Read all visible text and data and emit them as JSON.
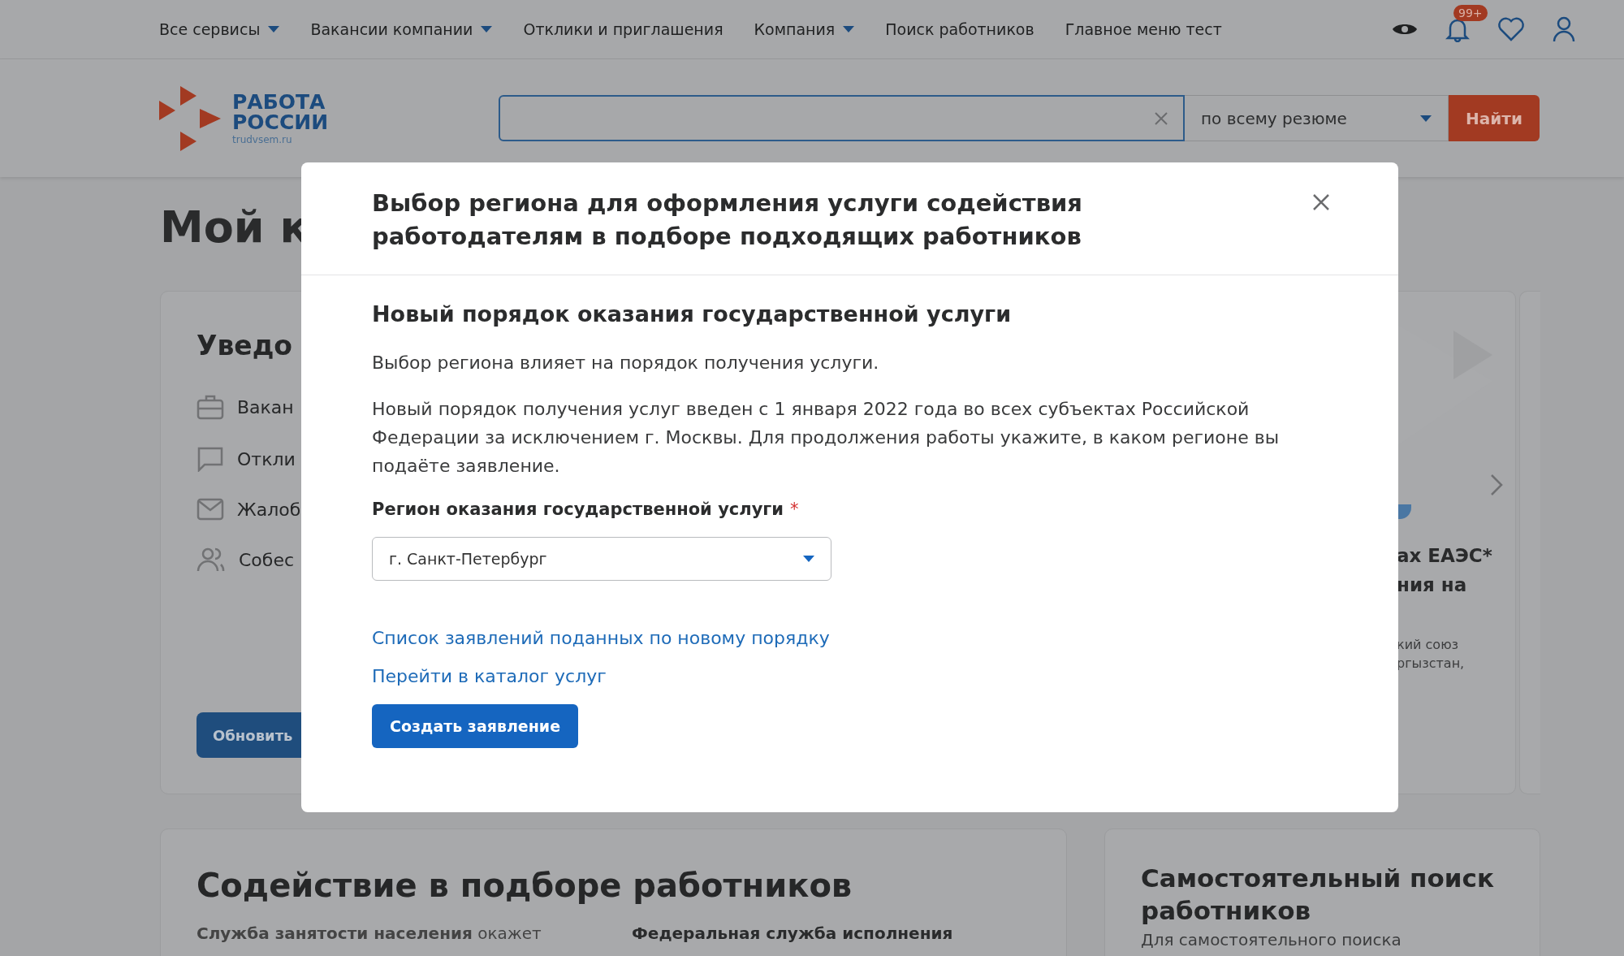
{
  "nav": {
    "items": [
      {
        "label": "Все сервисы",
        "dropdown": true
      },
      {
        "label": "Вакансии компании",
        "dropdown": true
      },
      {
        "label": "Отклики и приглашения",
        "dropdown": false
      },
      {
        "label": "Компания",
        "dropdown": true
      },
      {
        "label": "Поиск работников",
        "dropdown": false
      },
      {
        "label": "Главное меню тест",
        "dropdown": false
      }
    ],
    "notifications_badge": "99+"
  },
  "logo": {
    "line_1": "РАБОТА",
    "line_2": "РОССИИ",
    "domain": "trudvsem.ru"
  },
  "search": {
    "scope": "по всему резюме",
    "button": "Найти"
  },
  "page_title": "Мой к",
  "notifications_card": {
    "title": "Уведо",
    "items": [
      {
        "kind": "briefcase",
        "label": "Вакан"
      },
      {
        "kind": "chat",
        "label": "Откли"
      },
      {
        "kind": "mail",
        "label": "Жалоб"
      },
      {
        "kind": "people",
        "label": "Собес"
      }
    ],
    "button": "Обновить"
  },
  "promo_card": {
    "title_lines": [
      "ах ЕАЭС*",
      "ния на"
    ],
    "text_lines": [
      "кий союз",
      "ргызстан,"
    ]
  },
  "assistance_card": {
    "title": "Содействие в подборе работников",
    "column_1": "**Служба занятости населения** окажет",
    "column_2": "Федеральная служба исполнения"
  },
  "self_search_card": {
    "title": "Самостоятельный поиск работников",
    "text": "Для самостоятельного поиска"
  },
  "modal": {
    "title": "Выбор региона для оформления услуги содействия работодателям в подборе подходящих работников",
    "heading": "Новый порядок оказания государственной услуги",
    "paragraphs": [
      "Выбор региона влияет на порядок получения услуги.",
      "Новый порядок получения услуг введен с 1 января 2022 года во всех субъектах Российской Федерации за исключением г. Москвы. Для продолжения работы укажите, в каком регионе вы подаёте заявление."
    ],
    "field": {
      "label": "Регион оказания государственной услуги",
      "required_mark": "*",
      "value": "г. Санкт-Петербург"
    },
    "links": [
      "Список заявлений поданных по новому порядку",
      "Перейти в каталог услуг"
    ],
    "button": "Создать заявление"
  }
}
